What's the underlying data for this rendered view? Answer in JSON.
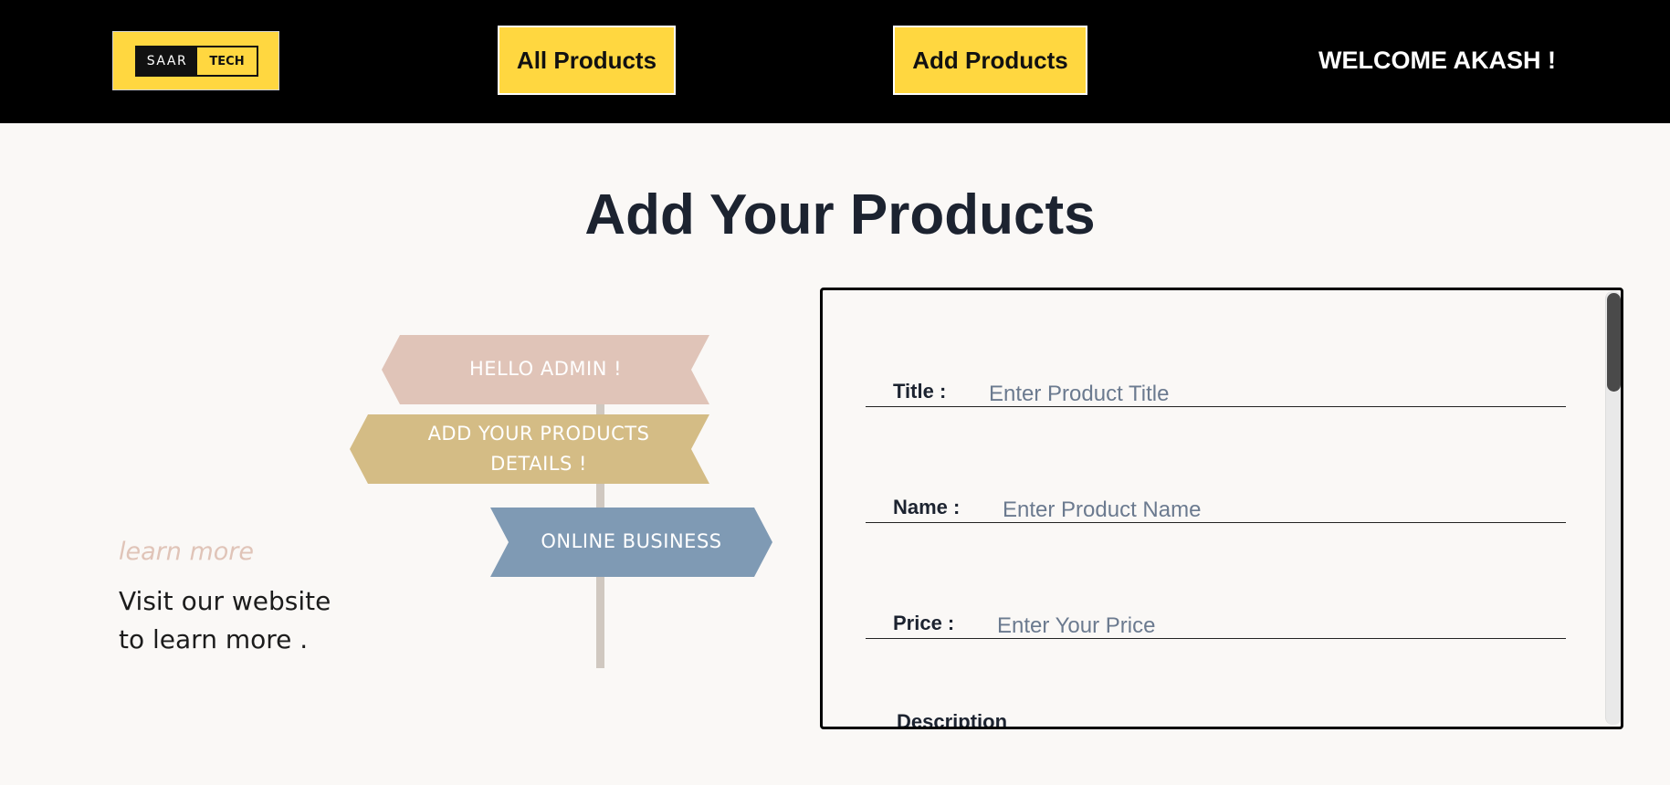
{
  "header": {
    "logo": {
      "left_text": "SAAR",
      "right_text": "TECH"
    },
    "nav": {
      "all_products": "All Products",
      "add_products": "Add Products"
    },
    "welcome": "WELCOME AKASH !"
  },
  "page": {
    "title": "Add Your Products"
  },
  "promo": {
    "signs": {
      "hello": "HELLO ADMIN !",
      "add_line1": "ADD YOUR PRODUCTS",
      "add_line2": "DETAILS !",
      "online": "ONLINE BUSINESS"
    },
    "learn_more": "learn more",
    "visit_line1": "Visit our website",
    "visit_line2": "to learn more ."
  },
  "form": {
    "title": {
      "label": "Title :",
      "placeholder": "Enter Product Title",
      "value": ""
    },
    "name": {
      "label": "Name :",
      "placeholder": "Enter Product Name",
      "value": ""
    },
    "price": {
      "label": "Price :",
      "placeholder": "Enter Your Price",
      "value": ""
    },
    "description": {
      "label": "Description"
    }
  },
  "colors": {
    "header_bg": "#000000",
    "accent_yellow": "#ffd740",
    "sign_pink": "#e0c4b8",
    "sign_gold": "#d4bc85",
    "sign_blue": "#7f9ab4",
    "post": "#d0c8c0"
  }
}
